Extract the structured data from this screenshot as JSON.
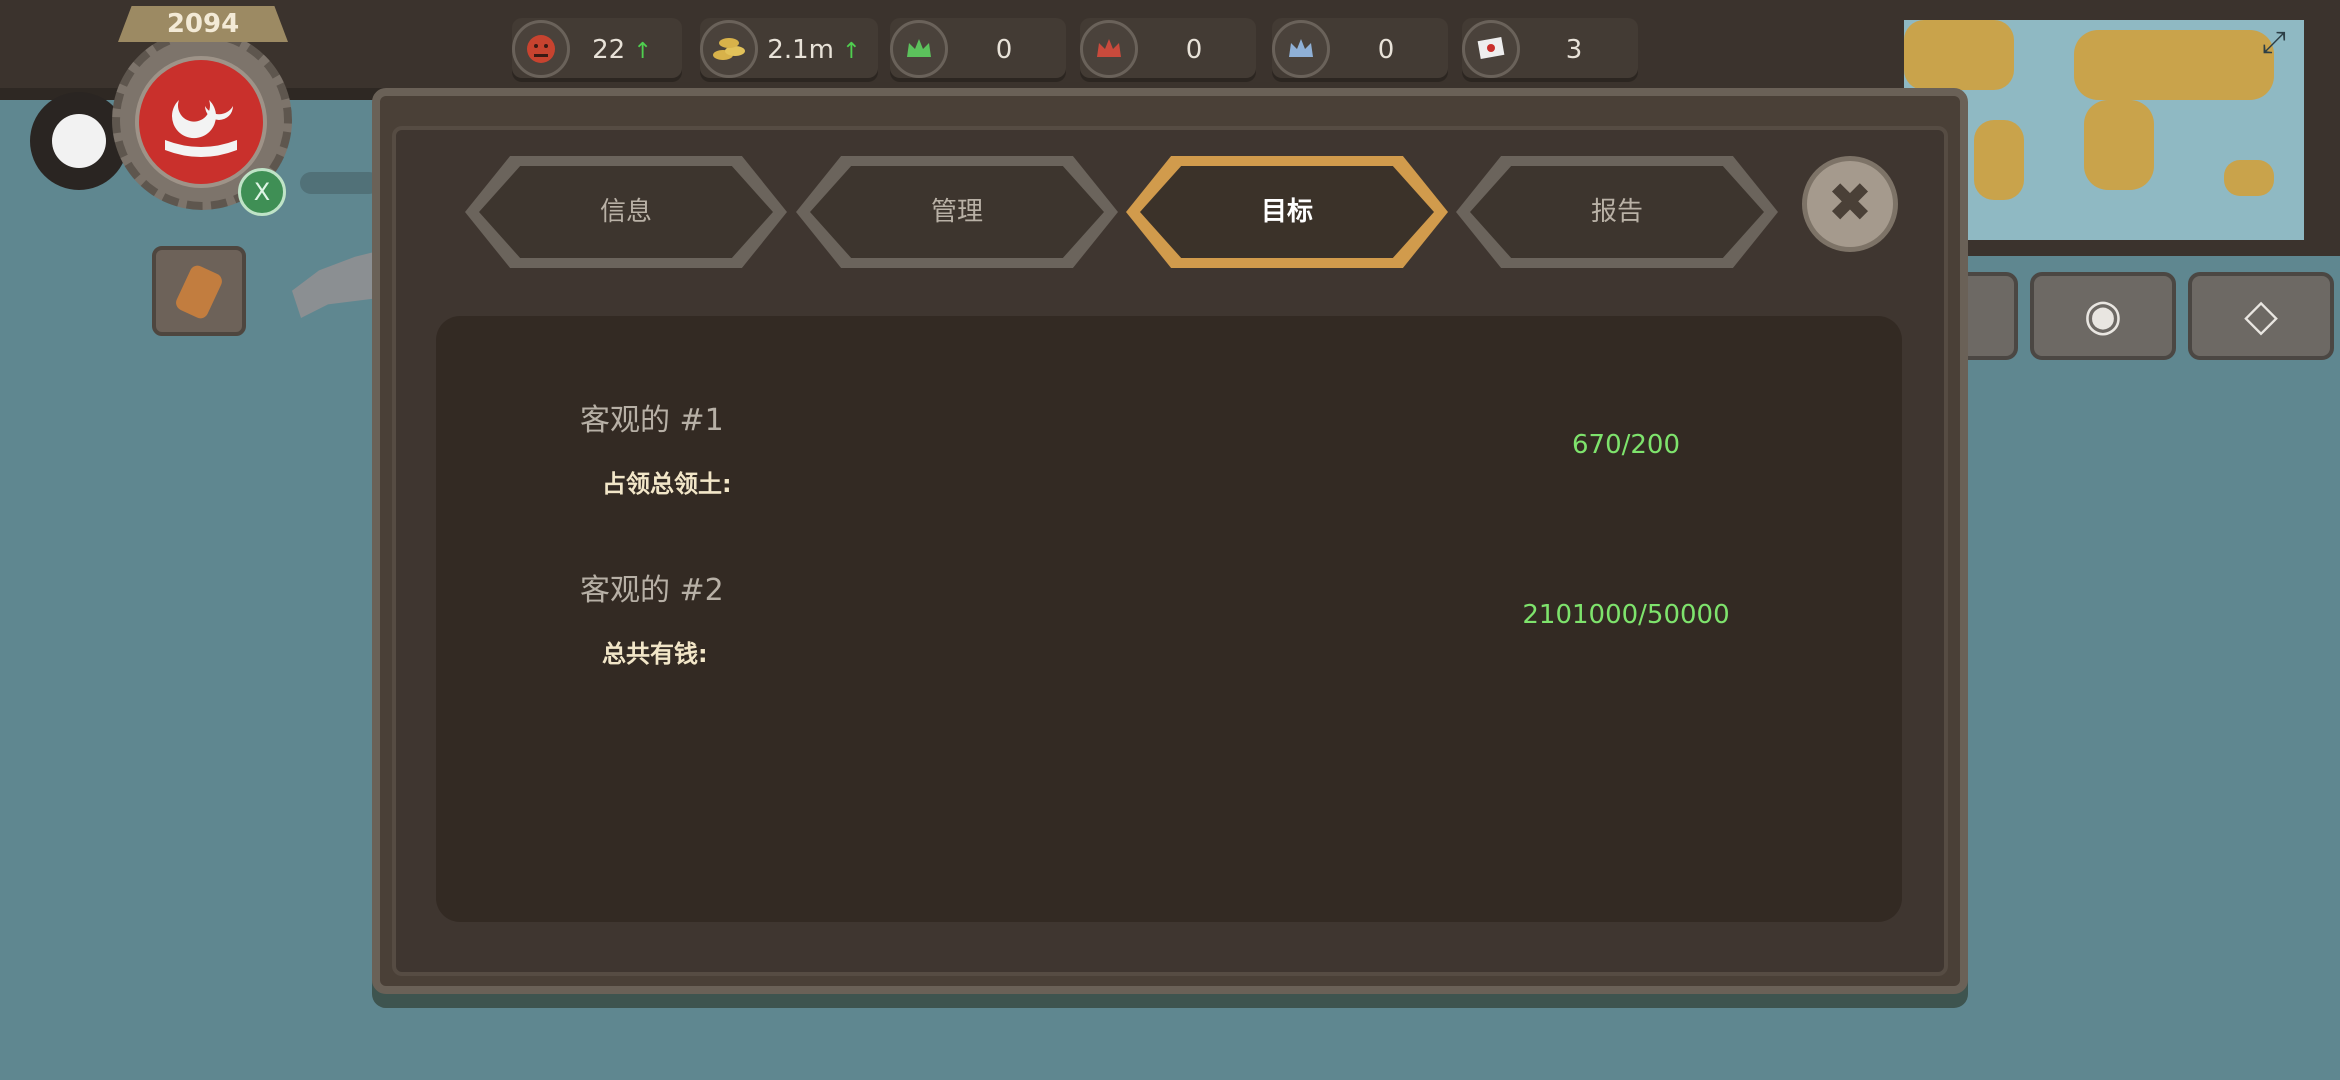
{
  "topbar": {
    "stats": [
      {
        "icon": "unrest-face-icon",
        "value": "22",
        "trend": "↑"
      },
      {
        "icon": "gold-coins-icon",
        "value": "2.1m",
        "trend": "↑"
      },
      {
        "icon": "green-crown-icon",
        "value": "0"
      },
      {
        "icon": "red-crown-icon",
        "value": "0"
      },
      {
        "icon": "blue-crown-icon",
        "value": "0"
      },
      {
        "icon": "flag-icon",
        "value": "3"
      }
    ]
  },
  "country": {
    "year": "2094",
    "badge_letter": "X"
  },
  "dialog": {
    "tabs": [
      {
        "label": "信息",
        "active": false
      },
      {
        "label": "管理",
        "active": false
      },
      {
        "label": "目标",
        "active": true
      },
      {
        "label": "报告",
        "active": false
      }
    ],
    "close_icon": "close-icon",
    "objectives": [
      {
        "title": "客观的 #1",
        "label": "占领总领土:",
        "value": "670/200"
      },
      {
        "title": "客观的 #2",
        "label": "总共有钱:",
        "value": "2101000/50000"
      }
    ]
  },
  "right_buttons": [
    "globe-icon",
    "diamond-icon"
  ],
  "colors": {
    "accent": "#d19b4c",
    "progress_text": "#7ee36c",
    "sea": "#5f8790"
  }
}
